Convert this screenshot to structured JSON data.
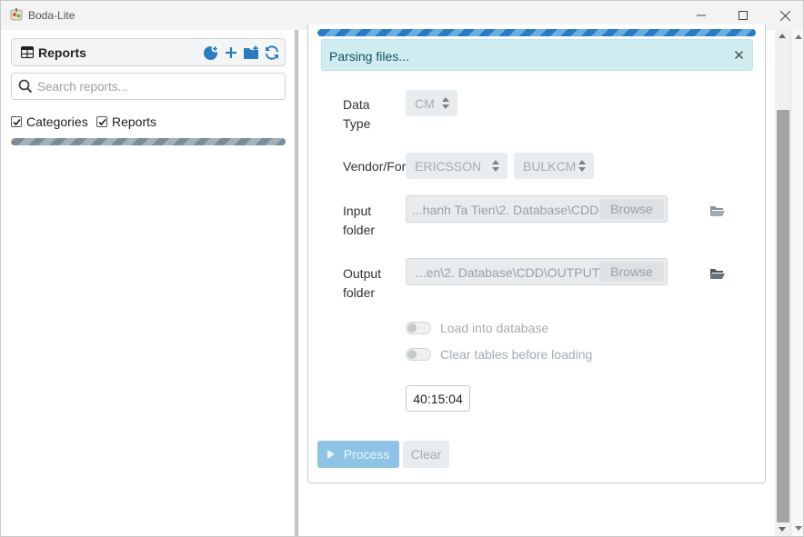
{
  "window": {
    "title": "Boda-Lite"
  },
  "left": {
    "header_title": "Reports",
    "search_placeholder": "Search reports...",
    "search_value": "",
    "checkbox_categories": "Categories",
    "checkbox_reports": "Reports",
    "categories_checked": true,
    "reports_checked": true
  },
  "main": {
    "alert_text": "Parsing files...",
    "data_type_label_1": "Data",
    "data_type_label_2": "Type",
    "data_type_value": "CM",
    "vendor_label": "Vendor/Format",
    "vendor_value": "ERICSSON",
    "format_value": "BULKCM",
    "input_label_1": "Input",
    "input_label_2": "folder",
    "input_path": "...hanh Ta Tien\\2. Database\\CDD",
    "input_browse": "Browse",
    "output_label_1": "Output",
    "output_label_2": "folder",
    "output_path": "...en\\2. Database\\CDD\\OUTPUT",
    "output_browse": "Browse",
    "load_db_label": "Load into database",
    "clear_tables_label": "Clear tables before loading",
    "load_db_on": false,
    "clear_tables_on": false,
    "elapsed_time": "40:15:04",
    "process_label": "Process",
    "clear_label": "Clear"
  },
  "colors": {
    "accent": "#2a7bbf",
    "alert_bg": "#d1ecf1",
    "alert_text": "#0c5460",
    "disabled_bg": "#e9ecef"
  }
}
